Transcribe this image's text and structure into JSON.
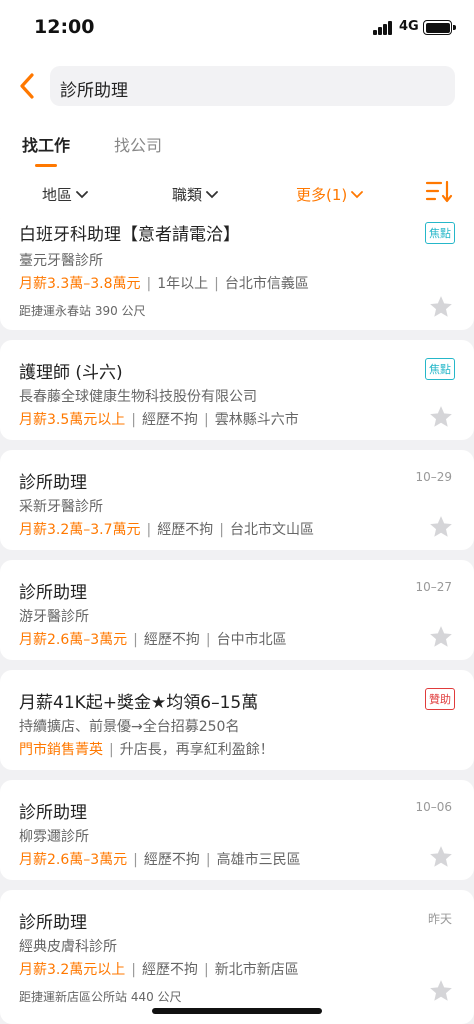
{
  "status": {
    "time": "12:00",
    "network": "4G"
  },
  "header": {
    "search_value": "診所助理",
    "tabs": [
      {
        "label": "找工作"
      },
      {
        "label": "找公司"
      }
    ],
    "filters": {
      "area": "地區",
      "title": "職類",
      "more": "更多(1)"
    }
  },
  "accent_color": "#ff7800",
  "jobs": [
    {
      "title": "白班牙科助理【意者請電洽】",
      "company": "臺元牙醫診所",
      "salary": "月薪3.3萬–3.8萬元",
      "experience": "1年以上",
      "location": "台北市信義區",
      "note": "距捷運永春站 390 公尺",
      "badge": "焦點"
    },
    {
      "title": "護理師 (斗六)",
      "company": "長春藤全球健康生物科技股份有限公司",
      "salary": "月薪3.5萬元以上",
      "experience": "經歷不拘",
      "location": "雲林縣斗六市",
      "badge": "焦點"
    },
    {
      "title": "診所助理",
      "company": "采新牙醫診所",
      "salary": "月薪3.2萬–3.7萬元",
      "experience": "經歷不拘",
      "location": "台北市文山區",
      "date": "10–29"
    },
    {
      "title": "診所助理",
      "company": "游牙醫診所",
      "salary": "月薪2.6萬–3萬元",
      "experience": "經歷不拘",
      "location": "台中市北區",
      "date": "10–27"
    },
    {
      "title": "月薪41K起+獎金★均領6–15萬",
      "company": "持續擴店、前景優→全台招募250名",
      "highlight": "門市銷售菁英",
      "rest": "升店長，再享紅利盈餘！",
      "badge": "贊助"
    },
    {
      "title": "診所助理",
      "company": "柳雰邇診所",
      "salary": "月薪2.6萬–3萬元",
      "experience": "經歷不拘",
      "location": "高雄市三民區",
      "date": "10–06"
    },
    {
      "title": "診所助理",
      "company": "經典皮膚科診所",
      "salary": "月薪3.2萬元以上",
      "experience": "經歷不拘",
      "location": "新北市新店區",
      "note": "距捷運新店區公所站 440 公尺",
      "date": "昨天"
    }
  ]
}
